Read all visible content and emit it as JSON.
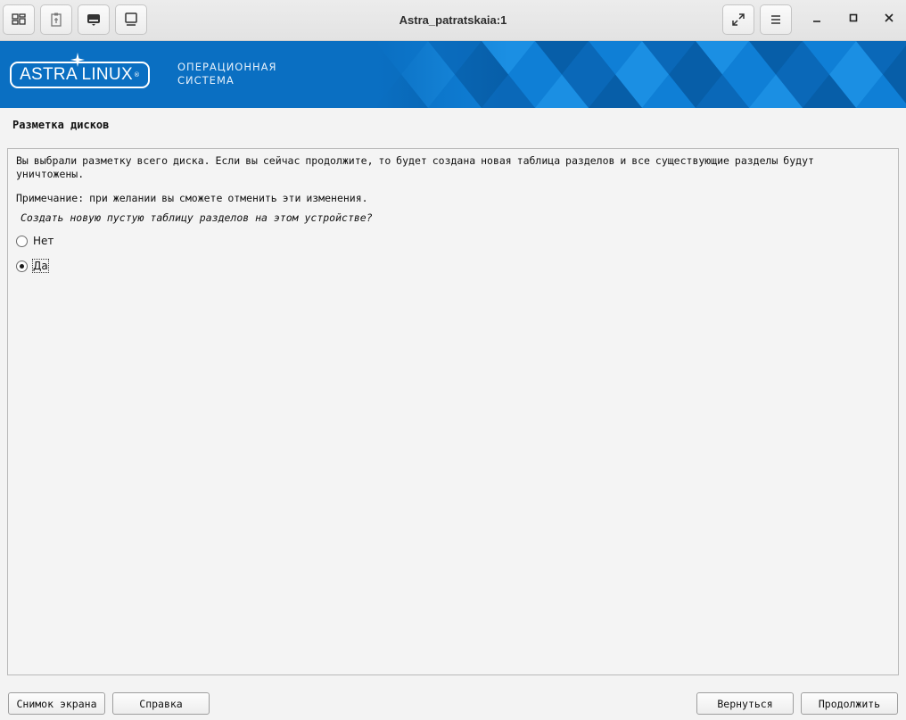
{
  "window": {
    "title": "Astra_patratskaia:1",
    "toolbar_icons": [
      "windows-icon",
      "clipboard-icon",
      "keyboard-icon",
      "monitor-icon"
    ],
    "controls": {
      "fullscreen": "fullscreen-icon",
      "menu": "menu-icon",
      "minimize": "_",
      "maximize": "□",
      "close": "✕"
    }
  },
  "banner": {
    "logo": "ASTRA LINUX",
    "logo_reg": "®",
    "subtitle_line1": "ОПЕРАЦИОННАЯ",
    "subtitle_line2": "СИСТЕМА",
    "color": "#0a6fc2"
  },
  "page": {
    "section_title": "Разметка дисков",
    "description": "Вы выбрали разметку всего диска. Если вы сейчас продолжите, то будет создана новая таблица разделов и все существующие разделы будут уничтожены.",
    "note": "Примечание: при желании вы сможете отменить эти изменения.",
    "question": "Создать новую пустую таблицу разделов на этом устройстве?",
    "options": [
      {
        "label": "Нет",
        "selected": false
      },
      {
        "label": "Да",
        "selected": true
      }
    ]
  },
  "buttons": {
    "screenshot": "Снимок экрана",
    "help": "Справка",
    "back": "Вернуться",
    "continue": "Продолжить"
  }
}
